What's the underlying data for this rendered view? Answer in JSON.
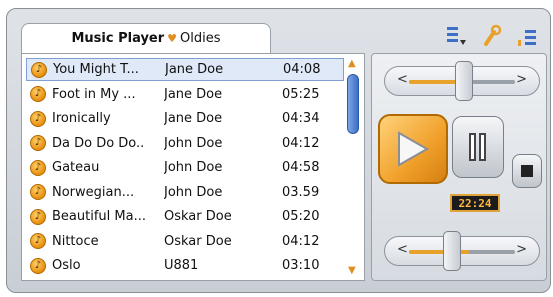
{
  "header": {
    "app_name": "Music Player",
    "separator": "♥",
    "playlist": "Oldies"
  },
  "toolbar_icons": [
    "sort-icon",
    "settings-icon",
    "signal-icon"
  ],
  "tracks": [
    {
      "title": "You Might T...",
      "artist": "Jane Doe",
      "time": "04:08",
      "selected": true
    },
    {
      "title": "Foot in My ...",
      "artist": "Jane Doe",
      "time": "05:25"
    },
    {
      "title": "Ironically",
      "artist": "Jane Doe",
      "time": "04:34"
    },
    {
      "title": "Da Do Do Do..",
      "artist": "John Doe",
      "time": "04:12"
    },
    {
      "title": "Gateau",
      "artist": "John Doe",
      "time": "04:58"
    },
    {
      "title": "Norwegian...",
      "artist": "John Doe",
      "time": "03.59"
    },
    {
      "title": "Beautiful Ma...",
      "artist": "Oskar Doe",
      "time": "05:20"
    },
    {
      "title": "Nittoce",
      "artist": "Oskar Doe",
      "time": "04:12"
    },
    {
      "title": "Oslo",
      "artist": "U881",
      "time": "03:10"
    }
  ],
  "controls": {
    "time_display": "22:24",
    "volume_min_symbol": "<",
    "volume_max_symbol": ">"
  },
  "colors": {
    "accent": "#e8a12a",
    "selection": "#dfe9f7",
    "scrollbar": "#3c6fc7"
  }
}
